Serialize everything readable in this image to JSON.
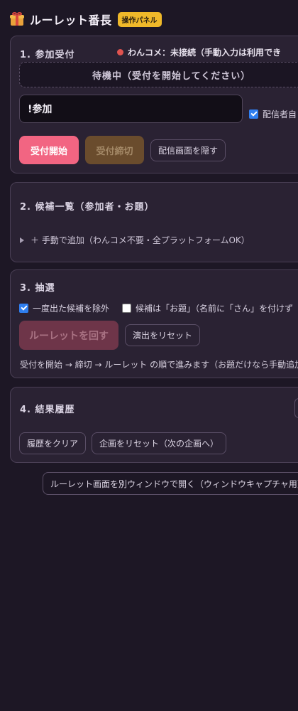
{
  "header": {
    "title": "ルーレット番長",
    "badge": "操作パネル"
  },
  "section1": {
    "title": "1. 参加受付",
    "status": "わんコメ：未接続（手動入力は利用でき",
    "waiting": "待機中（受付を開始してください）",
    "keyword_value": "!参加",
    "auto_label": "配信者自",
    "buttons": {
      "start": "受付開始",
      "close": "受付締切",
      "hide": "配信画面を隠す"
    }
  },
  "section2": {
    "title": "2. 候補一覧（参加者・お題）",
    "manual_add": "＋ 手動で追加（わんコメ不要・全プラットフォームOK）"
  },
  "section3": {
    "title": "3. 抽選",
    "exclude_label": "一度出た候補を除外",
    "topic_label": "候補は「お題」（名前に「さん」を付けず",
    "spin_button": "ルーレットを回す",
    "reset_effect": "演出をリセット",
    "hint": "受付を開始 → 締切 → ルーレット の順で進みます（お題だけなら手動追加"
  },
  "section4": {
    "title": "4. 結果履歴",
    "clear_history": "履歴をクリア",
    "reset_project": "企画をリセット（次の企画へ）"
  },
  "footer": {
    "open_window": "ルーレット画面を別ウィンドウで開く（ウィンドウキャプチャ用）"
  },
  "colors": {
    "accent": "#f26582",
    "badge": "#f0b92a",
    "status_dot": "#e0534f",
    "checkbox": "#2f7ff0"
  }
}
